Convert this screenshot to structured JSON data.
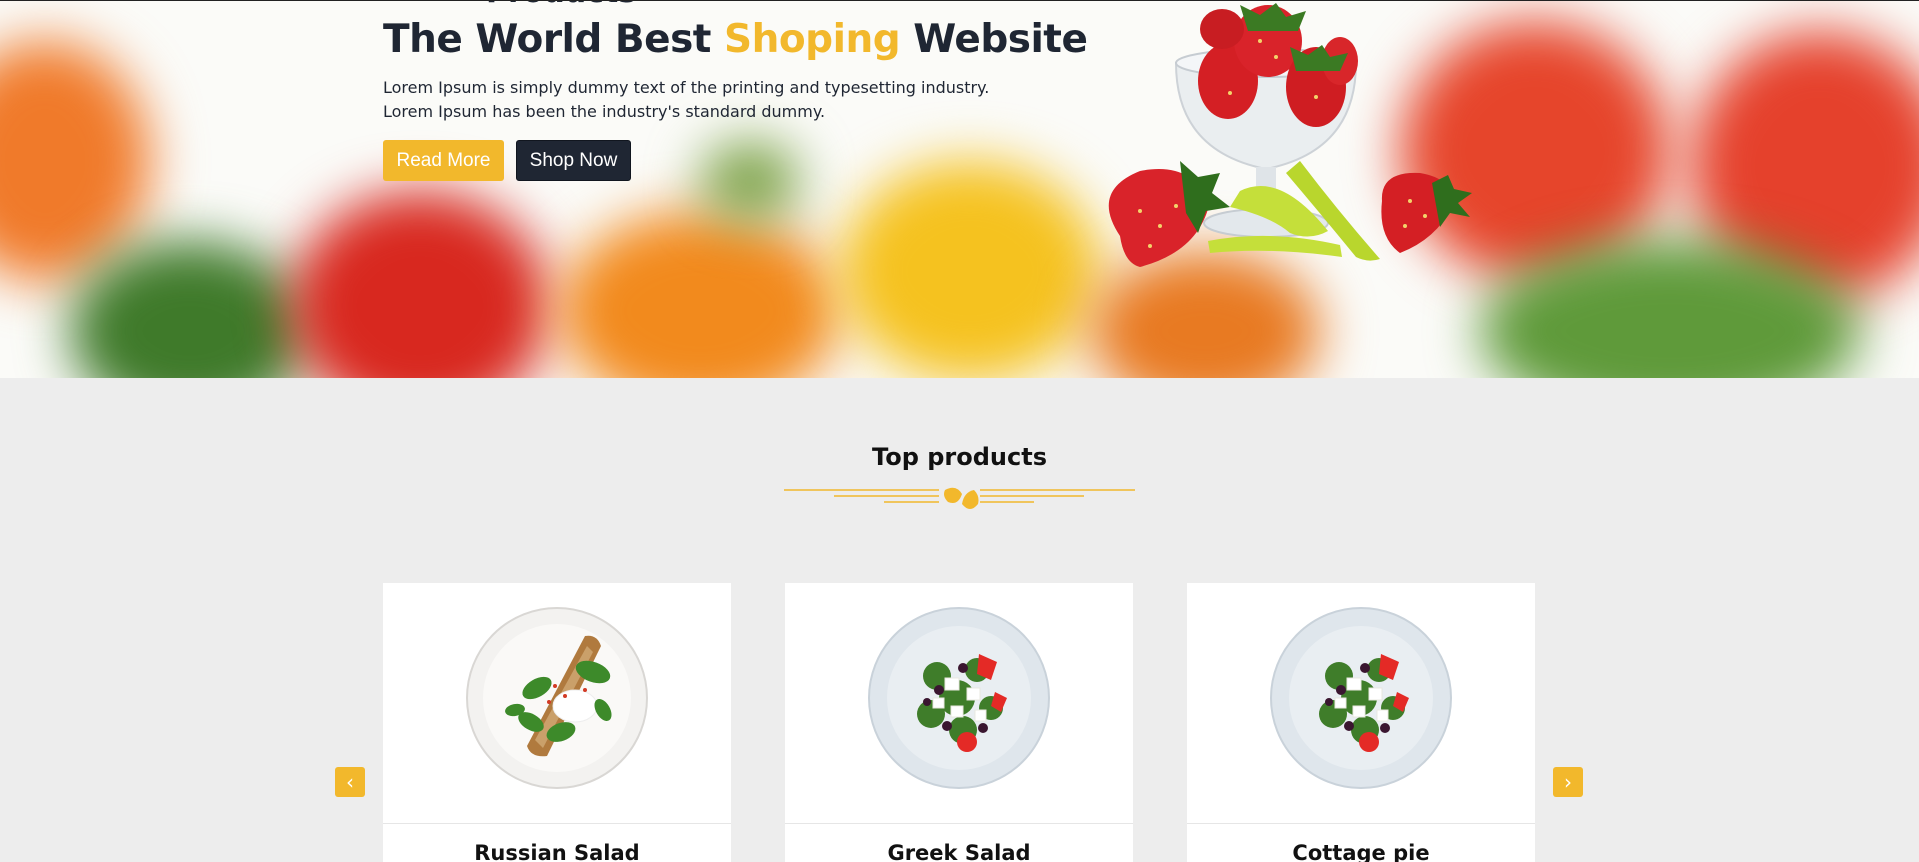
{
  "hero": {
    "clipped_heading": "Products",
    "title_part1": "The World Best ",
    "title_highlight": "Shoping",
    "title_part2": " Website",
    "description_line1": "Lorem Ipsum is simply dummy text of the printing and typesetting industry.",
    "description_line2": "Lorem Ipsum has been the industry's standard dummy.",
    "read_more_label": "Read More",
    "shop_now_label": "Shop Now"
  },
  "section": {
    "title": "Top products",
    "divider_icon": "leaf-icon"
  },
  "carousel": {
    "prev_label": "‹",
    "next_label": "›",
    "prev_icon": "chevron-left-icon",
    "next_icon": "chevron-right-icon"
  },
  "products": [
    {
      "name": "Russian Salad",
      "image": "toast-spinach-plate"
    },
    {
      "name": "Greek Salad",
      "image": "greek-salad-plate"
    },
    {
      "name": "Cottage pie",
      "image": "greek-salad-plate"
    }
  ],
  "colors": {
    "accent": "#f2b82c",
    "dark": "#1f2633",
    "section_bg": "#ededed"
  }
}
